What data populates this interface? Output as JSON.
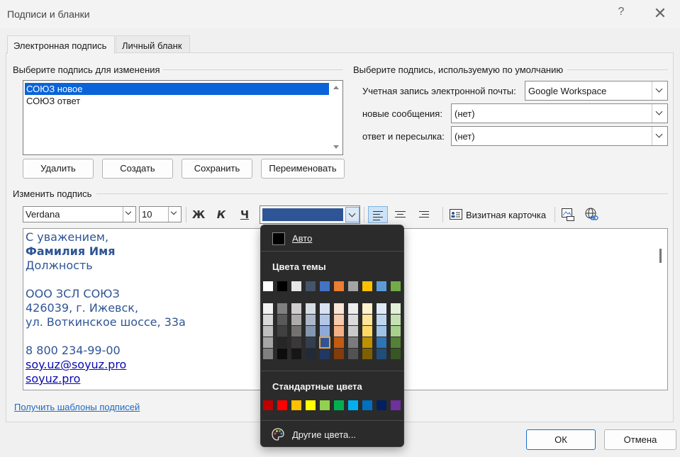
{
  "window": {
    "title": "Подписи и бланки",
    "help": "?",
    "close": "✕"
  },
  "tabs": [
    "Электронная подпись",
    "Личный бланк"
  ],
  "select_signature": {
    "label": "Выберите подпись для изменения",
    "items": [
      "СОЮЗ новое",
      "СОЮЗ ответ"
    ],
    "selected": 0
  },
  "buttons": {
    "delete": "Удалить",
    "create": "Создать",
    "save": "Сохранить",
    "rename": "Переименовать"
  },
  "defaults": {
    "label": "Выберите подпись, используемую по умолчанию",
    "account_label": "Учетная запись электронной почты:",
    "account_value": "Google Workspace",
    "new_label": "новые сообщения:",
    "new_value": "(нет)",
    "reply_label": "ответ и пересылка:",
    "reply_value": "(нет)"
  },
  "edit": {
    "label": "Изменить подпись",
    "font": "Verdana",
    "size": "10",
    "bold": "Ж",
    "italic": "К",
    "underline": "Ч",
    "font_color": "#2f5596",
    "business_card": "Визитная карточка"
  },
  "signature_lines": [
    {
      "text": "С уважением,",
      "style": "normal"
    },
    {
      "text": "Фамилия Имя",
      "style": "bold"
    },
    {
      "text": "Должность",
      "style": "normal"
    },
    {
      "text": "",
      "style": "normal"
    },
    {
      "text": "ООО ЗСЛ СОЮЗ",
      "style": "normal"
    },
    {
      "text": "426039, г. Ижевск,",
      "style": "normal"
    },
    {
      "text": "ул. Воткинское шоссе, 33а",
      "style": "normal"
    },
    {
      "text": "",
      "style": "normal"
    },
    {
      "text": "8 800 234-99-00",
      "style": "normal"
    },
    {
      "text": "soy.uz@soyuz.pro",
      "style": "link"
    },
    {
      "text": "soyuz.pro",
      "style": "link"
    }
  ],
  "templates_link": "Получить шаблоны подписей",
  "footer": {
    "ok": "ОК",
    "cancel": "Отмена"
  },
  "color_popup": {
    "auto": "Авто",
    "theme_title": "Цвета темы",
    "standard_title": "Стандартные цвета",
    "more": "Другие цвета...",
    "theme_top": [
      "#ffffff",
      "#000000",
      "#e7e6e6",
      "#44546a",
      "#4472c4",
      "#ed7d31",
      "#a5a5a5",
      "#ffc000",
      "#5b9bd5",
      "#70ad47"
    ],
    "theme_shades": [
      [
        "#f2f2f2",
        "#d9d9d9",
        "#bfbfbf",
        "#a6a6a6",
        "#808080"
      ],
      [
        "#808080",
        "#595959",
        "#404040",
        "#262626",
        "#0d0d0d"
      ],
      [
        "#d0cece",
        "#aeabab",
        "#757171",
        "#3a3838",
        "#171616"
      ],
      [
        "#d6dce4",
        "#adb9ca",
        "#8497b0",
        "#333f4f",
        "#222a35"
      ],
      [
        "#d9e2f3",
        "#b4c6e7",
        "#8eaadb",
        "#2f5597",
        "#1f3864"
      ],
      [
        "#fbe5d5",
        "#f7cbac",
        "#f4b183",
        "#c55a11",
        "#833c0b"
      ],
      [
        "#ededed",
        "#dbdbdb",
        "#c9c9c9",
        "#7b7b7b",
        "#525252"
      ],
      [
        "#fff2cc",
        "#fee599",
        "#ffd966",
        "#bf9000",
        "#7f6000"
      ],
      [
        "#deebf6",
        "#bdd7ee",
        "#9dc3e6",
        "#2e75b5",
        "#1f4e79"
      ],
      [
        "#e2efd9",
        "#c5e0b3",
        "#a8d08d",
        "#538135",
        "#375623"
      ]
    ],
    "selected_shade": {
      "column": 4,
      "row": 3
    },
    "standard": [
      "#c00000",
      "#ff0000",
      "#ffc000",
      "#ffff00",
      "#92d050",
      "#00b050",
      "#00b0f0",
      "#0070c0",
      "#002060",
      "#7030a0"
    ]
  }
}
